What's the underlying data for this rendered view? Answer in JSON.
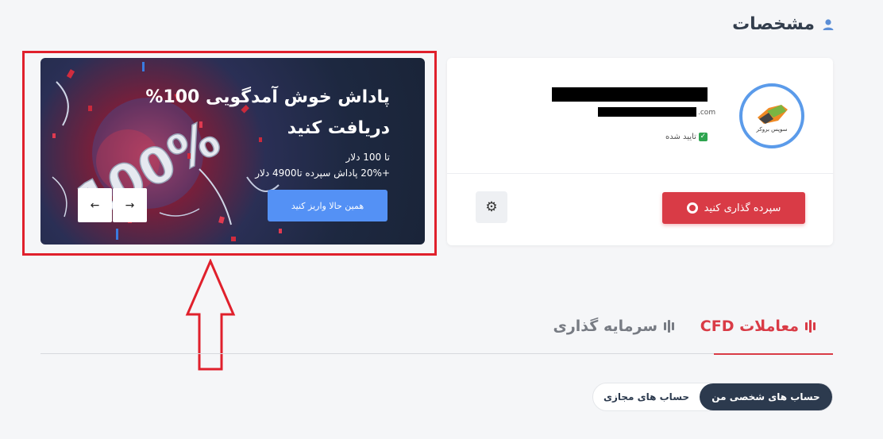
{
  "section": {
    "title": "مشخصات",
    "icon": "user-icon"
  },
  "profile": {
    "avatar_brand": "سوپس بروکر",
    "email_tail": ".com",
    "verified_label": "تایید شده",
    "deposit_label": "سپرده گذاری کنید",
    "settings_icon": "gear-icon"
  },
  "banner": {
    "title": "پاداش خوش آمدگویی 100% دریافت کنید",
    "line1": "تا 100 دلار",
    "line2": "+20% پاداش سپرده تا4900 دلار",
    "cta_label": "همین حالا واریز کنید",
    "badge_text": "100%",
    "prev_icon": "←",
    "next_icon": "→"
  },
  "tabs": [
    {
      "label": "معاملات CFD",
      "active": true
    },
    {
      "label": "سرمایه گذاری",
      "active": false
    }
  ],
  "accounts_switch": {
    "personal": "حساب های شخصی من",
    "virtual": "حساب های مجازی",
    "selected": "personal"
  },
  "colors": {
    "accent_red": "#d93b46",
    "cta_blue": "#5491f5",
    "annotation_red": "#e0202c",
    "dark_navy": "#2c3a4e"
  }
}
